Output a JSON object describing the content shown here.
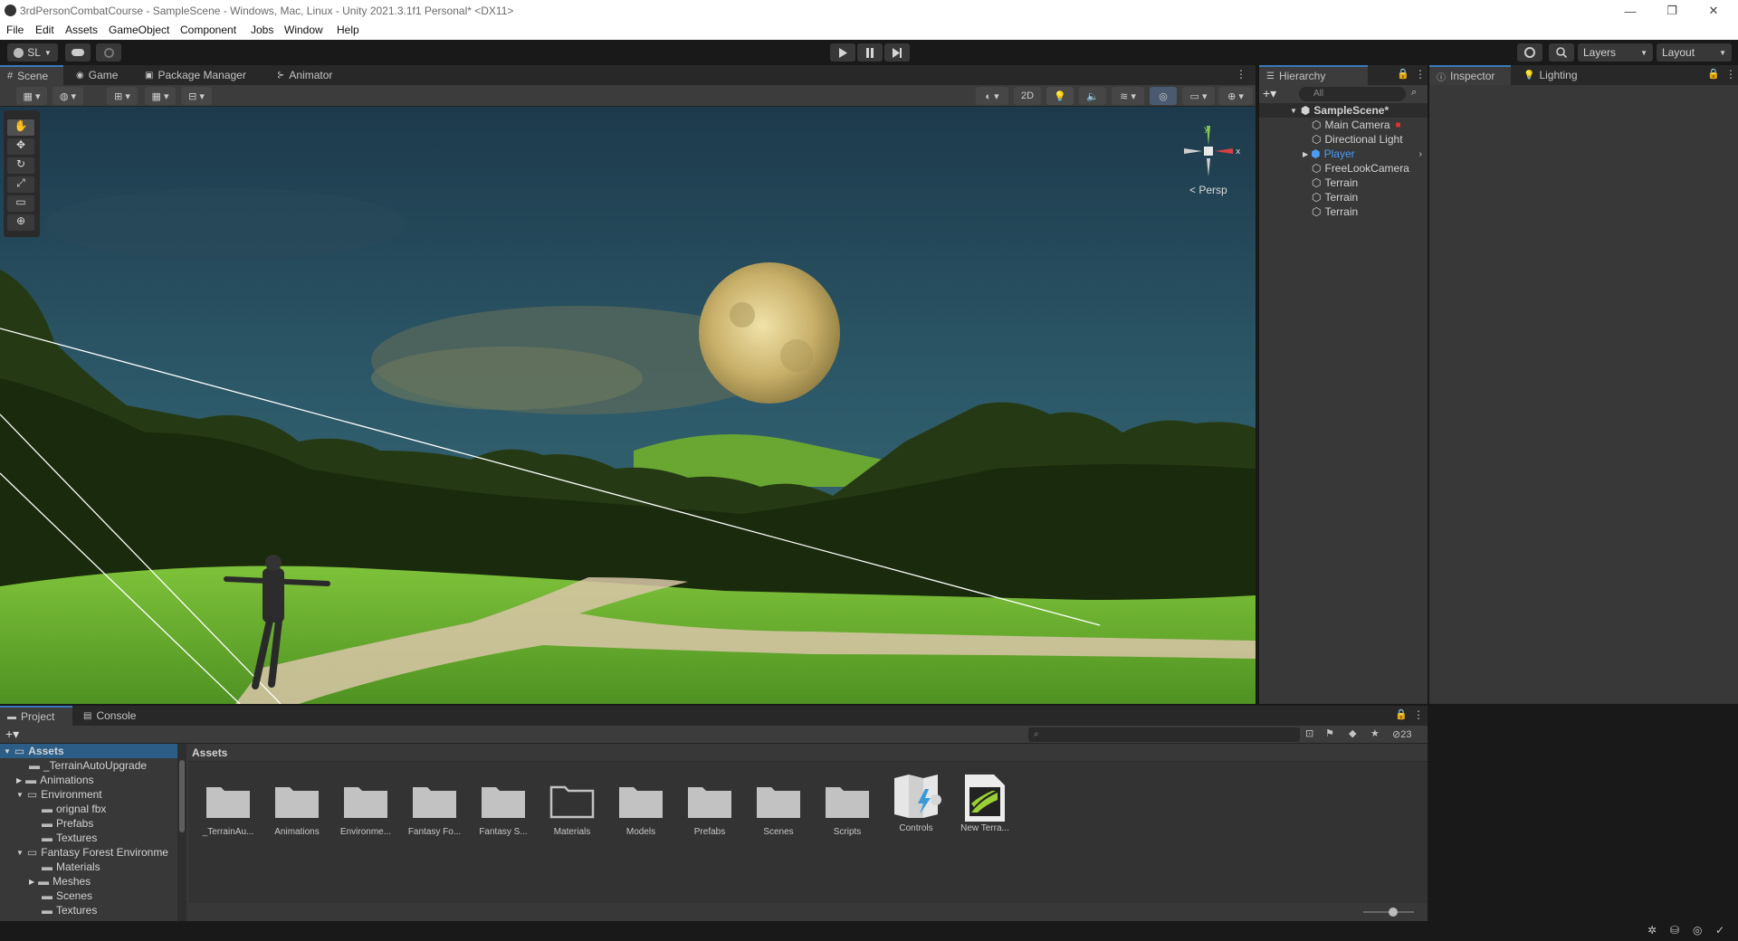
{
  "window": {
    "title": "3rdPersonCombatCourse - SampleScene - Windows, Mac, Linux - Unity 2021.3.1f1 Personal* <DX11>",
    "minimize": "—",
    "restore": "❐",
    "close": "✕"
  },
  "menu": [
    "File",
    "Edit",
    "Assets",
    "GameObject",
    "Component",
    "Jobs",
    "Window",
    "Help"
  ],
  "toolbar": {
    "account": "SL",
    "layers": "Layers",
    "layout": "Layout"
  },
  "scene_tabs": [
    {
      "label": "Scene",
      "icon": "grid-icon"
    },
    {
      "label": "Game",
      "icon": "gamepad-icon"
    },
    {
      "label": "Package Manager",
      "icon": "package-icon"
    },
    {
      "label": "Animator",
      "icon": "animator-icon"
    }
  ],
  "scene_options": {
    "mode_2d": "2D",
    "projection": "Persp"
  },
  "hierarchy": {
    "tab": "Hierarchy",
    "search_placeholder": "All",
    "scene": "SampleScene*",
    "items": [
      "Main Camera",
      "Directional Light",
      "Player",
      "FreeLookCamera",
      "Terrain",
      "Terrain",
      "Terrain"
    ],
    "selected_color": "#4c9bf5"
  },
  "inspector": {
    "tabs": [
      "Inspector",
      "Lighting"
    ]
  },
  "project": {
    "tabs": [
      "Project",
      "Console"
    ],
    "hidden_count": "23",
    "breadcrumb": "Assets",
    "tree": [
      {
        "label": "Assets",
        "depth": 0,
        "arrow": "down",
        "bold": true
      },
      {
        "label": "_TerrainAutoUpgrade",
        "depth": 1,
        "arrow": "none"
      },
      {
        "label": "Animations",
        "depth": 1,
        "arrow": "right"
      },
      {
        "label": "Environment",
        "depth": 1,
        "arrow": "down"
      },
      {
        "label": "orignal fbx",
        "depth": 2,
        "arrow": "none"
      },
      {
        "label": "Prefabs",
        "depth": 2,
        "arrow": "none"
      },
      {
        "label": "Textures",
        "depth": 2,
        "arrow": "none"
      },
      {
        "label": "Fantasy Forest Environme",
        "depth": 1,
        "arrow": "down"
      },
      {
        "label": "Materials",
        "depth": 2,
        "arrow": "none"
      },
      {
        "label": "Meshes",
        "depth": 2,
        "arrow": "right"
      },
      {
        "label": "Scenes",
        "depth": 2,
        "arrow": "none"
      },
      {
        "label": "Textures",
        "depth": 2,
        "arrow": "none"
      }
    ],
    "assets": [
      {
        "label": "_TerrainAu...",
        "kind": "folder"
      },
      {
        "label": "Animations",
        "kind": "folder"
      },
      {
        "label": "Environme...",
        "kind": "folder"
      },
      {
        "label": "Fantasy Fo...",
        "kind": "folder"
      },
      {
        "label": "Fantasy S...",
        "kind": "folder"
      },
      {
        "label": "Materials",
        "kind": "folder-empty"
      },
      {
        "label": "Models",
        "kind": "folder"
      },
      {
        "label": "Prefabs",
        "kind": "folder"
      },
      {
        "label": "Scenes",
        "kind": "folder"
      },
      {
        "label": "Scripts",
        "kind": "folder"
      },
      {
        "label": "Controls",
        "kind": "input-actions"
      },
      {
        "label": "New Terra...",
        "kind": "terrain-layer"
      }
    ]
  },
  "colors": {
    "accent": "#3a79bb",
    "panel": "#383838",
    "dark": "#191919"
  }
}
